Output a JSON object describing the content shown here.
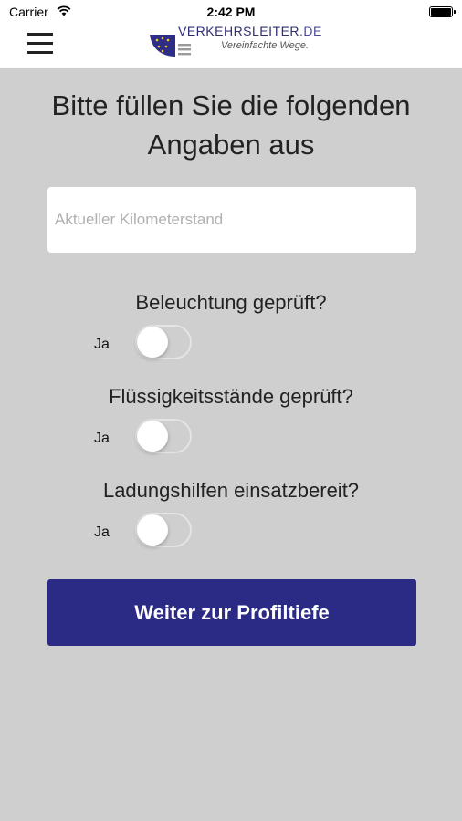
{
  "status_bar": {
    "carrier": "Carrier",
    "time": "2:42 PM"
  },
  "nav": {
    "logo_text": "VERKEHRSLEITER",
    "logo_domain": ".DE",
    "logo_tagline": "Vereinfachte Wege.",
    "menu_icon": "hamburger-menu-icon"
  },
  "form": {
    "heading": "Bitte füllen Sie die folgenden Angaben aus",
    "km_placeholder": "Aktueller Kilometerstand",
    "km_value": "",
    "questions": [
      {
        "label": "Beleuchtung geprüft?",
        "toggle_label": "Ja",
        "checked": false
      },
      {
        "label": "Flüssigkeitsstände geprüft?",
        "toggle_label": "Ja",
        "checked": false
      },
      {
        "label": "Ladungshilfen einsatzbereit?",
        "toggle_label": "Ja",
        "checked": false
      }
    ],
    "submit_label": "Weiter zur Profiltiefe"
  },
  "colors": {
    "background": "#cfcfcf",
    "button": "#2b2b86",
    "brand_text": "#2e2e74"
  }
}
